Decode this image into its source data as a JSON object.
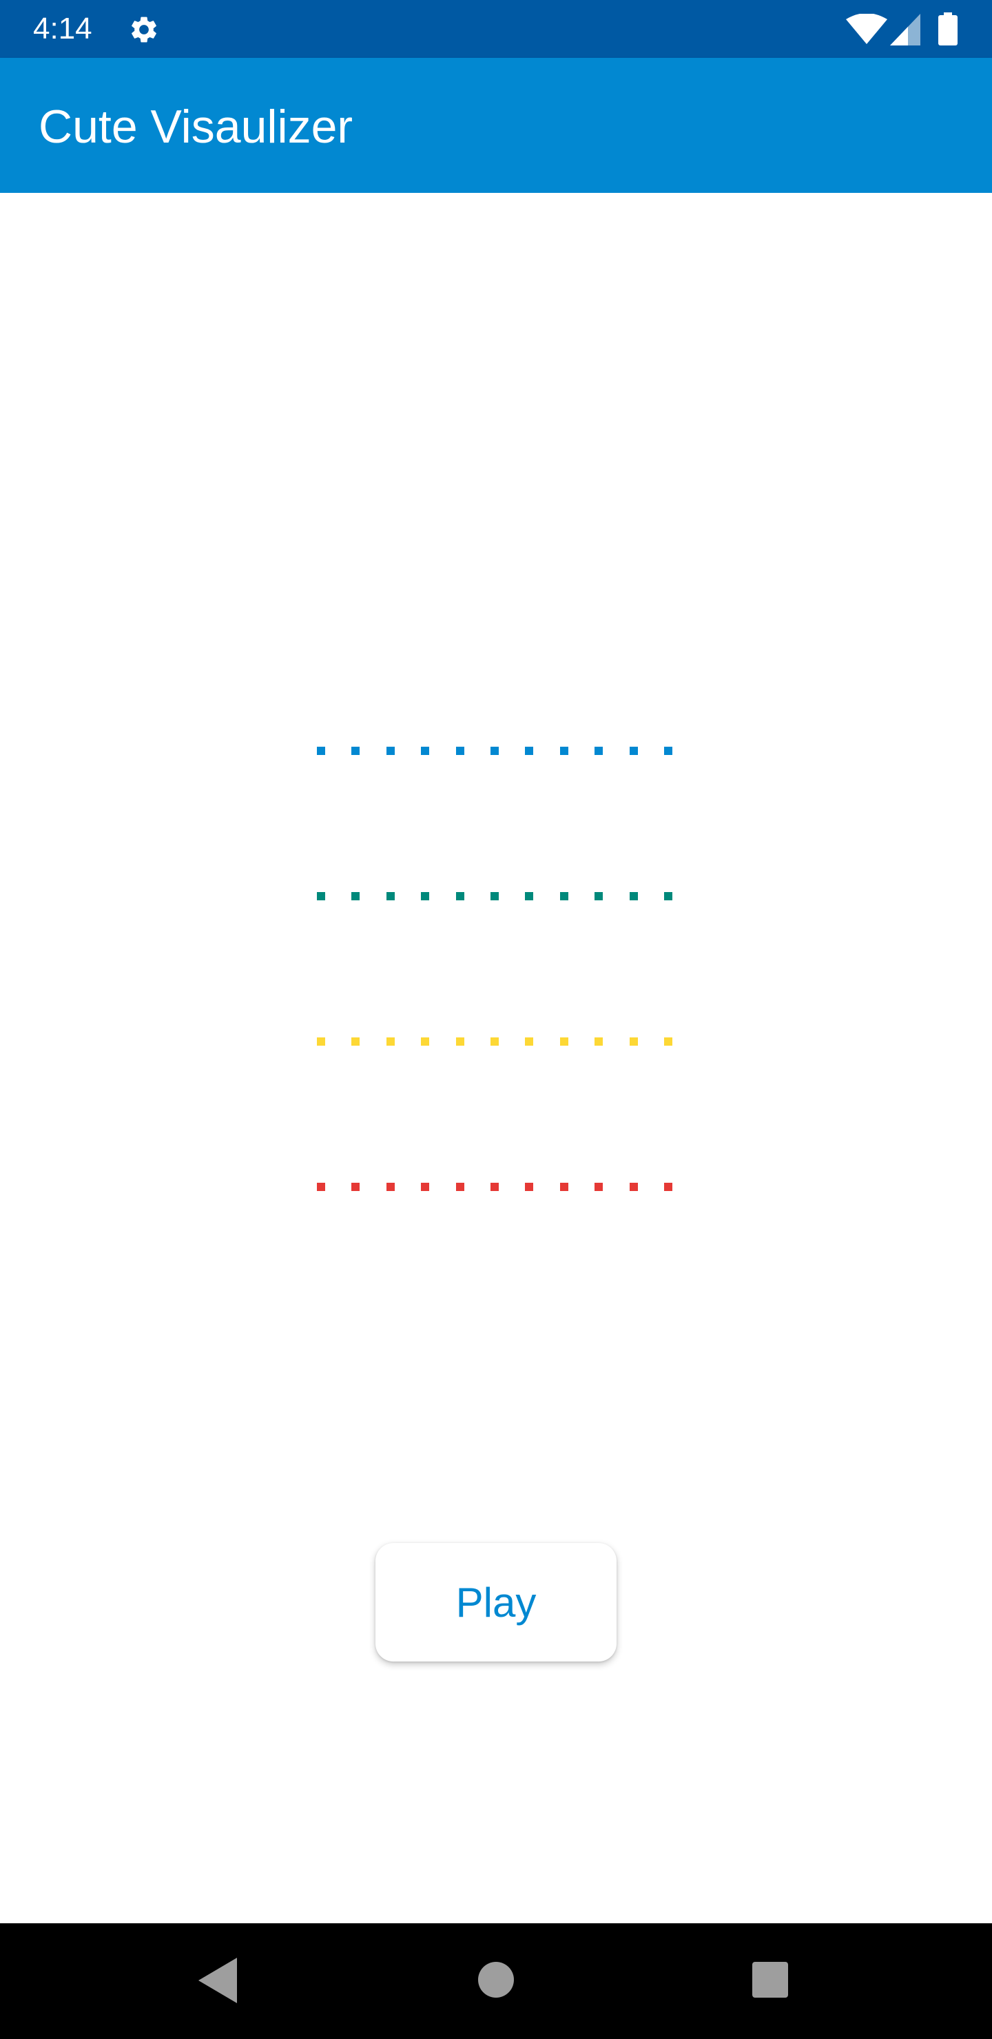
{
  "status_bar": {
    "time": "4:14",
    "icons": [
      "settings-gear-icon",
      "wifi-icon",
      "cell-signal-icon",
      "battery-icon"
    ],
    "background": "#0059a3"
  },
  "app_bar": {
    "title": "Cute Visaulizer",
    "background": "#0288d1"
  },
  "visualizer": {
    "rows": [
      {
        "name": "blue",
        "color": "#0288d1",
        "dots": 11
      },
      {
        "name": "teal",
        "color": "#00897b",
        "dots": 11
      },
      {
        "name": "yellow",
        "color": "#fdd835",
        "dots": 11
      },
      {
        "name": "red",
        "color": "#e53935",
        "dots": 11
      }
    ]
  },
  "play_button": {
    "label": "Play",
    "color": "#0288d1"
  },
  "nav_bar": {
    "icons": [
      "back-icon",
      "home-icon",
      "recents-icon"
    ]
  }
}
